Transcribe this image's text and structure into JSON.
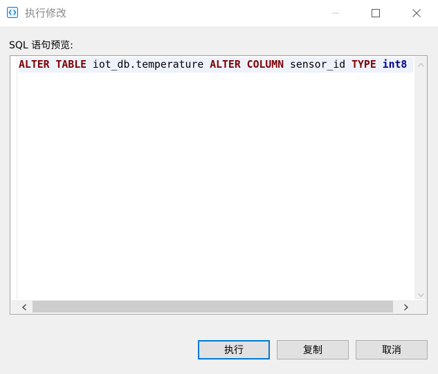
{
  "window": {
    "title": "执行修改",
    "app_icon": "code-brackets-icon",
    "controls": [
      "minimize-icon",
      "maximize-icon",
      "close-icon"
    ],
    "accent_color": "#0078d7"
  },
  "label": {
    "sql_preview": "SQL 语句预览:"
  },
  "editor": {
    "tokens": {
      "t1": "ALTER",
      "s1": " ",
      "t2": "TABLE",
      "s2": " iot_db.temperature ",
      "t3": "ALTER",
      "s3": " ",
      "t4": "COLUMN",
      "s4": " sensor_id ",
      "t5": "TYPE",
      "s5": " ",
      "t6": "int8"
    },
    "keyword_color": "#7f0000",
    "type_color": "#00007f"
  },
  "buttons": {
    "execute": "执行",
    "copy": "复制",
    "cancel": "取消"
  }
}
